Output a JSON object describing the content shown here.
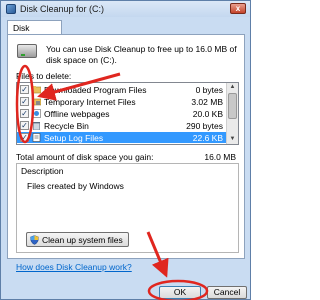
{
  "window": {
    "title": "Disk Cleanup for  (C:)",
    "close_glyph": "x"
  },
  "tabs": [
    {
      "label": "Disk Cleanup"
    }
  ],
  "intro": "You can use Disk Cleanup to free up to 16.0 MB of disk space on  (C:).",
  "files_label": "Files to delete:",
  "files": [
    {
      "name": "Downloaded Program Files",
      "size": "0 bytes",
      "checked": true,
      "icon": "folder-icon"
    },
    {
      "name": "Temporary Internet Files",
      "size": "3.02 MB",
      "checked": true,
      "icon": "lock-folder-icon"
    },
    {
      "name": "Offline webpages",
      "size": "20.0 KB",
      "checked": true,
      "icon": "webpage-icon"
    },
    {
      "name": "Recycle Bin",
      "size": "290 bytes",
      "checked": true,
      "icon": "recycle-bin-icon"
    },
    {
      "name": "Setup Log Files",
      "size": "22.6 KB",
      "checked": true,
      "icon": "log-file-icon",
      "selected": true
    }
  ],
  "check_glyph": "✓",
  "total_label": "Total amount of disk space you gain:",
  "total_value": "16.0 MB",
  "description": {
    "title": "Description",
    "text": "Files created by Windows"
  },
  "cleanup_button": "Clean up system files",
  "help_link": "How does Disk Cleanup work?",
  "buttons": {
    "ok": "OK",
    "cancel": "Cancel"
  },
  "colors": {
    "annotation": "#e0261f",
    "selection": "#3399ff",
    "link": "#0066cc"
  }
}
